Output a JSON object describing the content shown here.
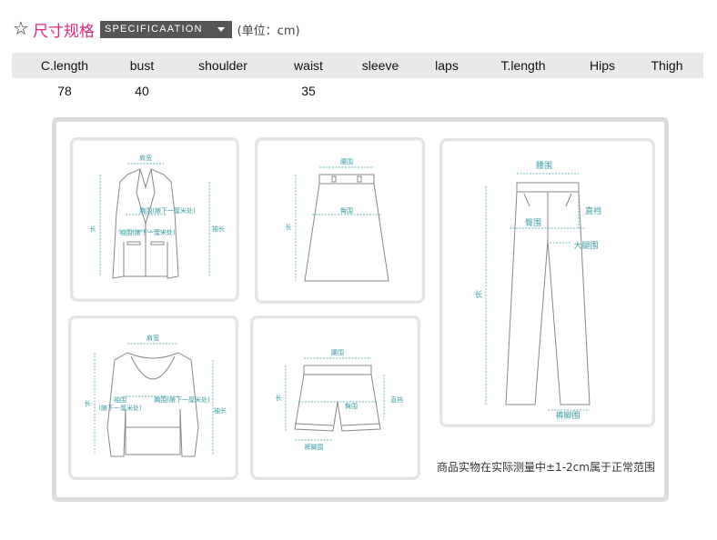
{
  "header": {
    "title_cn": "尺寸规格",
    "spec_label": "SPECIFICAATION",
    "unit": "(单位：cm)"
  },
  "table": {
    "columns": [
      "C.length",
      "bust",
      "shoulder",
      "waist",
      "sleeve",
      "laps",
      "T.length",
      "Hips",
      "Thigh"
    ],
    "values": [
      "78",
      "40",
      "",
      "35",
      "",
      "",
      "",
      "",
      ""
    ]
  },
  "diagrams": {
    "jacket": {
      "shoulder": "肩宽",
      "bust": "胸围(腋下一厘米处)",
      "waist": "袖围(腋下一厘米处)",
      "length": "长",
      "sleeve": "袖长"
    },
    "skirt": {
      "waist": "腰围",
      "hips": "臀围",
      "length": "长"
    },
    "pants": {
      "waist": "腰围",
      "hips": "臀围",
      "rise": "直裆",
      "thigh": "大腿围",
      "length": "长",
      "hem": "裤脚围"
    },
    "sweater": {
      "shoulder": "肩宽",
      "bust": "胸围(腋下一厘米处)",
      "sleeve_circ": "袖围",
      "sleeve_sub": "(腋下一厘米处)",
      "length": "长",
      "sleeve": "袖长"
    },
    "shorts": {
      "waist": "腰围",
      "hips": "臀围",
      "length": "长",
      "rise": "直裆",
      "hem": "裤脚围"
    }
  },
  "note": "商品实物在实际测量中±1-2cm属于正常范围",
  "colors": {
    "title": "#e0287c",
    "spec_bg": "#555555",
    "guide": "#3a9ea5",
    "table_head_bg": "#e9e9e9"
  }
}
